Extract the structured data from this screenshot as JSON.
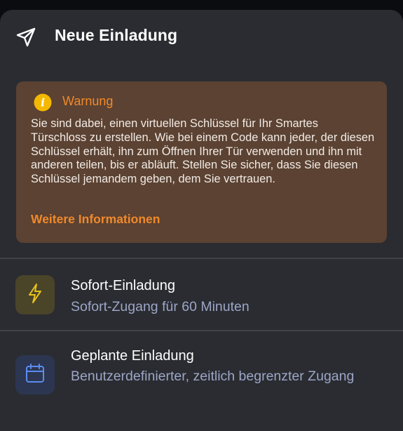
{
  "header": {
    "title": "Neue Einladung",
    "icon": "send-icon"
  },
  "warning": {
    "title": "Warnung",
    "icon": "info-icon",
    "body": "Sie sind dabei, einen virtuellen Schlüssel für Ihr Smartes Türschloss zu erstellen. Wie bei einem Code kann jeder, der diesen Schlüssel erhält, ihn zum Öffnen Ihrer Tür verwenden und ihn mit anderen teilen, bis er abläuft. Stellen Sie sicher, dass Sie diesen Schlüssel jemandem geben, dem Sie vertrauen.",
    "link_label": "Weitere Informationen"
  },
  "options": [
    {
      "title": "Sofort-Einladung",
      "subtitle": "Sofort-Zugang für 60 Minuten",
      "icon": "lightning-icon"
    },
    {
      "title": "Geplante Einladung",
      "subtitle": "Benutzerdefinierter, zeitlich begrenzter Zugang",
      "icon": "calendar-icon"
    }
  ],
  "colors": {
    "background": "#2a2c31",
    "warning_bg": "#5b4232",
    "accent_orange": "#f0892c",
    "info_yellow": "#f5b800",
    "instant_tile": "#4a4429",
    "instant_icon": "#e8c21c",
    "scheduled_tile": "#2c3650",
    "scheduled_icon": "#5b8cf0",
    "subtitle": "#9ca6c6"
  }
}
